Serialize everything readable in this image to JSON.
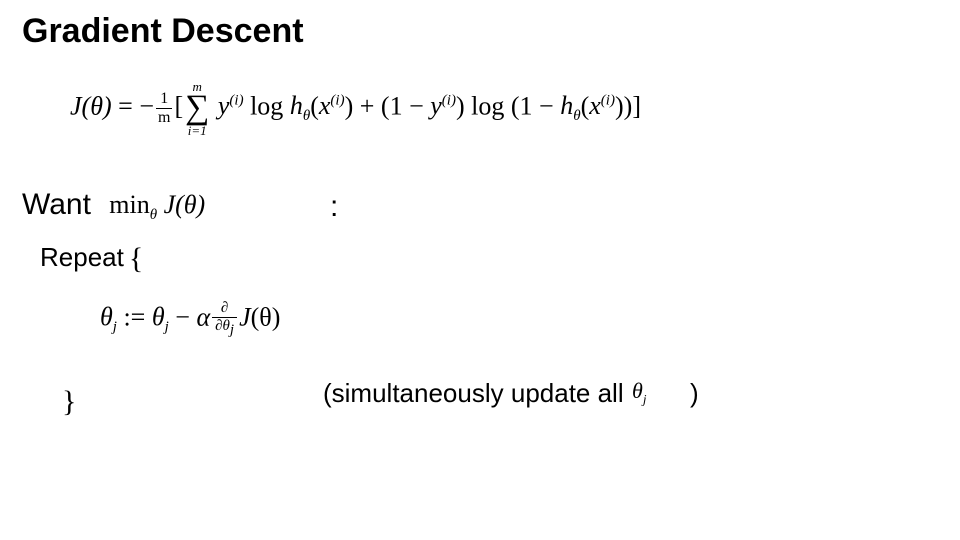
{
  "title": "Gradient Descent",
  "cost_formula": {
    "lhs": "J(θ)",
    "eq": " = ",
    "neg": "−",
    "frac_num": "1",
    "frac_den": "m",
    "lbrack": "[",
    "sum_top": "m",
    "sum_sigma": "∑",
    "sum_bot": "i=1",
    "term1_y": "y",
    "term1_y_sup": "(i)",
    "log1": " log ",
    "h1": "h",
    "h1_sub": "θ",
    "h1_arg_open": "(",
    "h1_x": "x",
    "h1_x_sup": "(i)",
    "h1_arg_close": ")",
    "plus": " + ",
    "one_minus_y_open": "(1 − ",
    "one_minus_y_y": "y",
    "one_minus_y_sup": "(i)",
    "one_minus_y_close": ")",
    "log2": " log ",
    "log2_open": "(1 − ",
    "h2": "h",
    "h2_sub": "θ",
    "h2_arg_open": "(",
    "h2_x": "x",
    "h2_x_sup": "(i)",
    "h2_arg_close": ")",
    "log2_close": ")",
    "rbrack": "]"
  },
  "want": {
    "label": "Want",
    "min": "min",
    "min_sub": "θ",
    "j": " J",
    "arg": "(θ)",
    "colon": ":"
  },
  "repeat": {
    "label": "Repeat",
    "open_brace": "{",
    "close_brace": "}"
  },
  "update": {
    "theta_j_lhs": "θ",
    "j_sub": "j",
    "assign": " := ",
    "theta_j_rhs": "θ",
    "minus": " − ",
    "alpha": "α",
    "frac_num": "∂",
    "frac_den_d": "∂θ",
    "frac_den_sub": "j",
    "j_func": "J",
    "j_arg": "(θ)"
  },
  "note": {
    "text": "(simultaneously update all",
    "theta": "θ",
    "theta_sub": "j",
    "close": ")"
  }
}
